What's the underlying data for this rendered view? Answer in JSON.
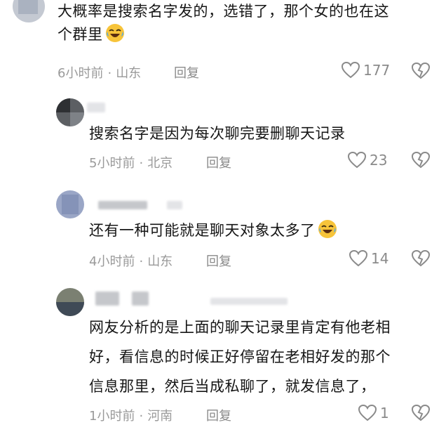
{
  "comments": [
    {
      "text_lines": [
        "大概率是搜索名字发的，选错了，那个女的也在这",
        "个群里"
      ],
      "emoji": "laughing-crying-emoji",
      "time": "6小时前",
      "location": "山东",
      "reply_label": "回复",
      "likes": "177"
    },
    {
      "text_lines": [
        "搜索名字是因为每次聊完要删聊天记录"
      ],
      "time": "5小时前",
      "location": "北京",
      "reply_label": "回复",
      "likes": "23"
    },
    {
      "text_lines": [
        "还有一种可能就是聊天对象太多了"
      ],
      "emoji": "laughing-crying-emoji",
      "time": "4小时前",
      "location": "山东",
      "reply_label": "回复",
      "likes": "14"
    },
    {
      "text_lines": [
        "网友分析的是上面的聊天记录里肯定有他老相",
        "好，看信息的时候正好停留在老相好发的那个",
        "信息那里，然后当成私聊了，就发信息了，"
      ],
      "time": "1小时前",
      "location": "河南",
      "reply_label": "回复",
      "likes": "1"
    }
  ],
  "separator": "·",
  "icons": {
    "like": "heart-outline-icon",
    "dislike": "broken-heart-icon"
  },
  "colors": {
    "meta": "#9a9a9a",
    "text": "#161616",
    "emoji_face": "#f7c43a"
  }
}
